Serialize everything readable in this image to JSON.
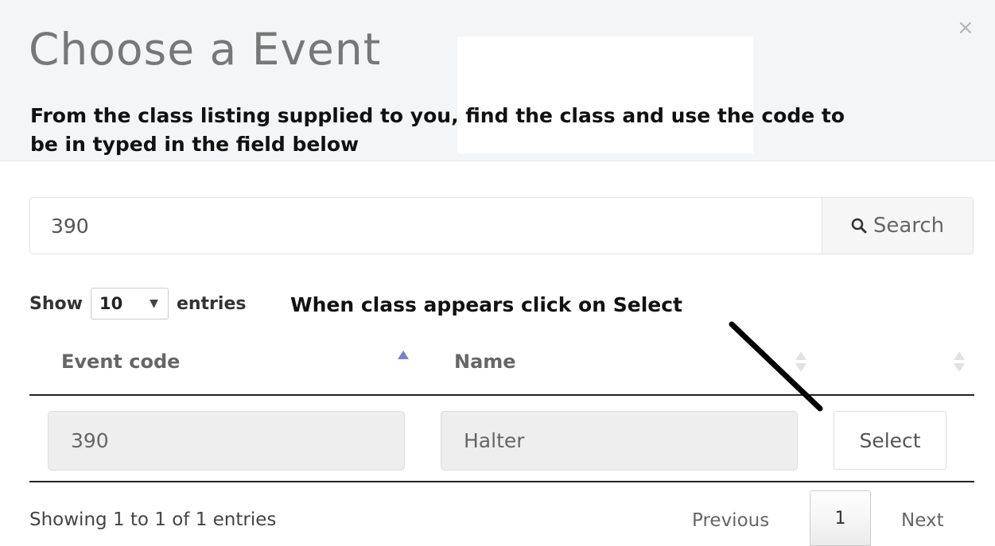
{
  "modal": {
    "title": "Choose a Event",
    "close_glyph": "×"
  },
  "annotations": {
    "instruction_1": "From the class listing supplied to you, find the class and use the code to be in typed in the field below",
    "instruction_2": "When class appears click on Select"
  },
  "search": {
    "value": "390",
    "button_label": "Search",
    "button_icon": "search-icon"
  },
  "length_menu": {
    "prefix": "Show",
    "selected": "10",
    "suffix": "entries"
  },
  "table": {
    "columns": [
      "Event code",
      "Name",
      ""
    ],
    "sort": {
      "column": "Event code",
      "direction": "ascending"
    },
    "rows": [
      {
        "event_code": "390",
        "name": "Halter",
        "action_label": "Select"
      }
    ]
  },
  "footer": {
    "info": "Showing 1 to 1 of 1 entries",
    "previous_label": "Previous",
    "current_page": "1",
    "next_label": "Next"
  },
  "colors": {
    "header_bg": "#f4f5f6",
    "sort_active": "#7d7fd0",
    "annotation_arrow": "#000000"
  }
}
